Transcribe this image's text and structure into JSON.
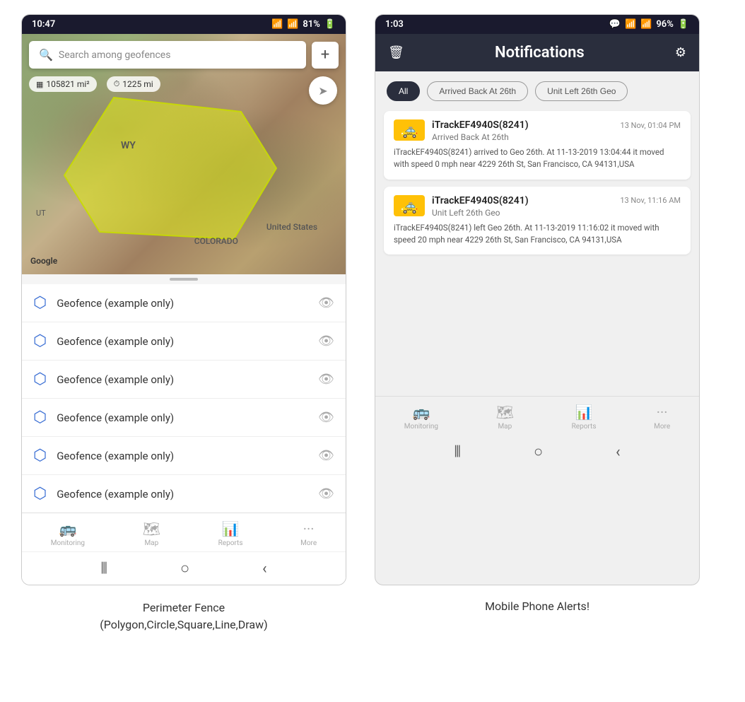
{
  "left_phone": {
    "status_bar": {
      "time": "10:47",
      "battery": "81%",
      "signal": "WiFi"
    },
    "search": {
      "placeholder": "Search among geofences"
    },
    "map_info": {
      "area": "105821 mi²",
      "distance": "1225 mi"
    },
    "map_labels": {
      "state": "WY",
      "country": "United States",
      "state2": "COLORADO",
      "state3": "UT",
      "google": "Google"
    },
    "geofence_items": [
      {
        "label": "Geofence (example only)"
      },
      {
        "label": "Geofence (example only)"
      },
      {
        "label": "Geofence (example only)"
      },
      {
        "label": "Geofence (example only)"
      },
      {
        "label": "Geofence (example only)"
      },
      {
        "label": "Geofence (example only)"
      }
    ],
    "bottom_nav": [
      {
        "label": "Monitoring",
        "icon": "🚌"
      },
      {
        "label": "Map",
        "icon": "🗺"
      },
      {
        "label": "Reports",
        "icon": "📊"
      },
      {
        "label": "More",
        "icon": "•••"
      }
    ]
  },
  "right_phone": {
    "status_bar": {
      "time": "1:03",
      "battery": "96%"
    },
    "header": {
      "title": "Notifications",
      "left_icon": "trash",
      "right_icon": "settings"
    },
    "filter_tabs": [
      {
        "label": "All",
        "active": true
      },
      {
        "label": "Arrived Back At 26th",
        "active": false
      },
      {
        "label": "Unit Left 26th Geo",
        "active": false
      }
    ],
    "notifications": [
      {
        "device": "iTrackEF4940S(8241)",
        "timestamp": "13 Nov, 01:04 PM",
        "event": "Arrived Back At 26th",
        "body": "iTrackEF4940S(8241) arrived to Geo 26th.    At 11-13-2019 13:04:44 it moved with speed 0 mph near 4229 26th St, San Francisco, CA 94131,USA"
      },
      {
        "device": "iTrackEF4940S(8241)",
        "timestamp": "13 Nov, 11:16 AM",
        "event": "Unit Left 26th Geo",
        "body": "iTrackEF4940S(8241) left Geo 26th.   At 11-13-2019 11:16:02 it moved with speed 20 mph near 4229 26th St, San Francisco, CA 94131,USA"
      }
    ],
    "bottom_nav": [
      {
        "label": "Monitoring",
        "icon": "🚌"
      },
      {
        "label": "Map",
        "icon": "🗺"
      },
      {
        "label": "Reports",
        "icon": "📊"
      },
      {
        "label": "More",
        "icon": "•••"
      }
    ]
  },
  "captions": {
    "left": "Perimeter Fence\n(Polygon,Circle,Square,Line,Draw)",
    "right": "Mobile Phone Alerts!"
  }
}
